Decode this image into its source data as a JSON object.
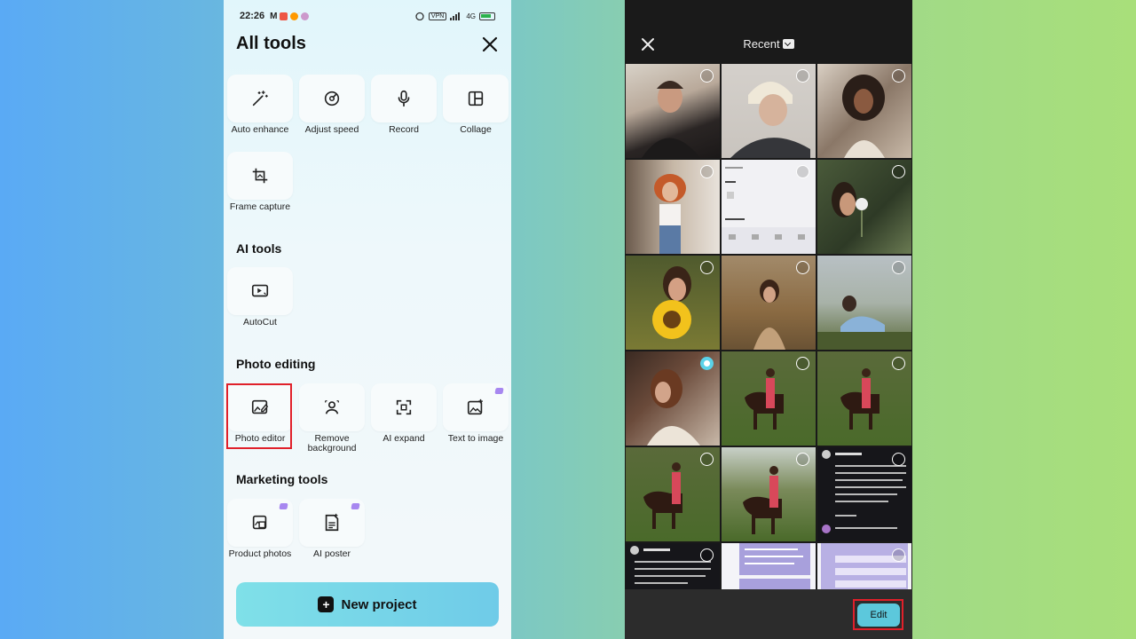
{
  "left": {
    "status": {
      "time": "22:26",
      "right_text": "4G"
    },
    "title": "All tools",
    "tools": [
      {
        "label": "Auto enhance"
      },
      {
        "label": "Adjust speed"
      },
      {
        "label": "Record"
      },
      {
        "label": "Collage"
      },
      {
        "label": "Frame capture"
      }
    ],
    "ai_tools": {
      "title": "AI tools",
      "items": [
        {
          "label": "AutoCut"
        }
      ]
    },
    "photo_editing": {
      "title": "Photo editing",
      "items": [
        {
          "label": "Photo editor"
        },
        {
          "label": "Remove background"
        },
        {
          "label": "AI expand"
        },
        {
          "label": "Text to image"
        }
      ]
    },
    "marketing": {
      "title": "Marketing tools",
      "items": [
        {
          "label": "Product photos"
        },
        {
          "label": "AI poster"
        }
      ]
    },
    "new_project": "New project"
  },
  "right": {
    "title": "Recent",
    "edit": "Edit",
    "colors": {
      "accent": "#5ad2e8",
      "highlight": "#e0202a"
    }
  }
}
